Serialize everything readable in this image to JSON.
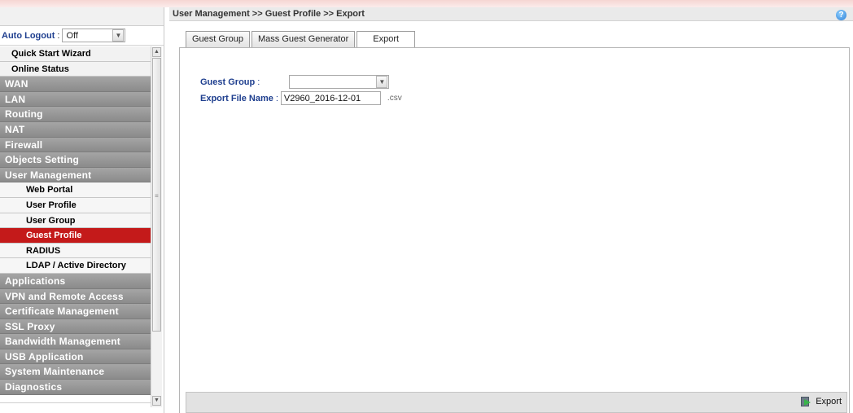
{
  "sidebar": {
    "auto_logout": {
      "label": "Auto Logout",
      "colon": ":",
      "value": "Off"
    },
    "items": [
      {
        "label": "Quick Start Wizard",
        "kind": "plain"
      },
      {
        "label": "Online Status",
        "kind": "plain"
      },
      {
        "label": "WAN",
        "kind": "group"
      },
      {
        "label": "LAN",
        "kind": "group"
      },
      {
        "label": "Routing",
        "kind": "group"
      },
      {
        "label": "NAT",
        "kind": "group"
      },
      {
        "label": "Firewall",
        "kind": "group"
      },
      {
        "label": "Objects Setting",
        "kind": "group"
      },
      {
        "label": "User Management",
        "kind": "group"
      },
      {
        "label": "Web Portal",
        "kind": "sub"
      },
      {
        "label": "User Profile",
        "kind": "sub"
      },
      {
        "label": "User Group",
        "kind": "sub"
      },
      {
        "label": "Guest Profile",
        "kind": "sub",
        "active": true
      },
      {
        "label": "RADIUS",
        "kind": "sub"
      },
      {
        "label": "LDAP / Active Directory",
        "kind": "sub"
      },
      {
        "label": "Applications",
        "kind": "group"
      },
      {
        "label": "VPN and Remote Access",
        "kind": "group"
      },
      {
        "label": "Certificate Management",
        "kind": "group"
      },
      {
        "label": "SSL Proxy",
        "kind": "group"
      },
      {
        "label": "Bandwidth Management",
        "kind": "group"
      },
      {
        "label": "USB Application",
        "kind": "group"
      },
      {
        "label": "System Maintenance",
        "kind": "group"
      },
      {
        "label": "Diagnostics",
        "kind": "group"
      }
    ]
  },
  "header": {
    "breadcrumb": "User Management >> Guest Profile >> Export",
    "help_icon": "?"
  },
  "tabs": [
    {
      "label": "Guest Group",
      "active": false
    },
    {
      "label": "Mass Guest Generator",
      "active": false
    },
    {
      "label": "Export",
      "active": true
    }
  ],
  "form": {
    "guest_group": {
      "label": "Guest Group",
      "colon": ":",
      "value": ""
    },
    "export_file_name": {
      "label": "Export File Name",
      "colon": ":",
      "value": "V2960_2016-12-01",
      "suffix": ".csv"
    }
  },
  "footer": {
    "export_label": "Export"
  },
  "colors": {
    "active_menu": "#c41a1a",
    "label_blue": "#1f3f8f",
    "menu_group_gray": "#999999"
  }
}
